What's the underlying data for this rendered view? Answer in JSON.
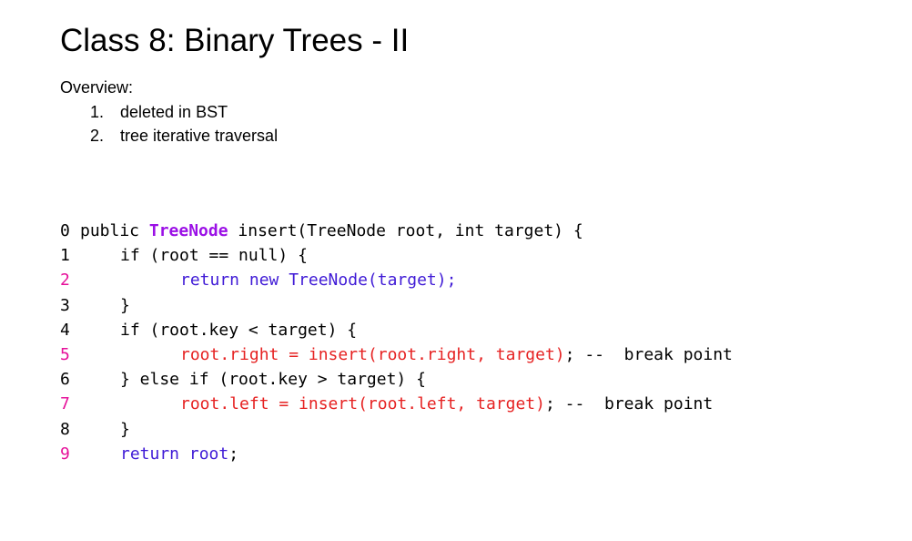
{
  "title": "Class 8: Binary Trees - II",
  "overview": {
    "label": "Overview:",
    "items": [
      {
        "num": "1.",
        "text": "deleted in BST"
      },
      {
        "num": "2.",
        "text": "tree iterative traversal"
      }
    ]
  },
  "code": {
    "lines": [
      {
        "n": "0",
        "segs": [
          "public ",
          "TreeNode",
          " insert(TreeNode root, int target) {"
        ]
      },
      {
        "n": "1",
        "segs": [
          "if (root == null) {"
        ]
      },
      {
        "n": "2",
        "segs": [
          "return new TreeNode(target);"
        ]
      },
      {
        "n": "3",
        "segs": [
          "}"
        ]
      },
      {
        "n": "4",
        "segs": [
          "if (root.key < target) {"
        ]
      },
      {
        "n": "5",
        "segs": [
          "root.right = insert(root.right, target)",
          ";",
          " --  break point"
        ]
      },
      {
        "n": "6",
        "segs": [
          "} else if (root.key > target) {"
        ]
      },
      {
        "n": "7",
        "segs": [
          "root.left = insert(root.left, target)",
          ";",
          " --  break point"
        ]
      },
      {
        "n": "8",
        "segs": [
          "}"
        ]
      },
      {
        "n": "9",
        "segs": [
          "return root",
          ";"
        ]
      }
    ]
  }
}
